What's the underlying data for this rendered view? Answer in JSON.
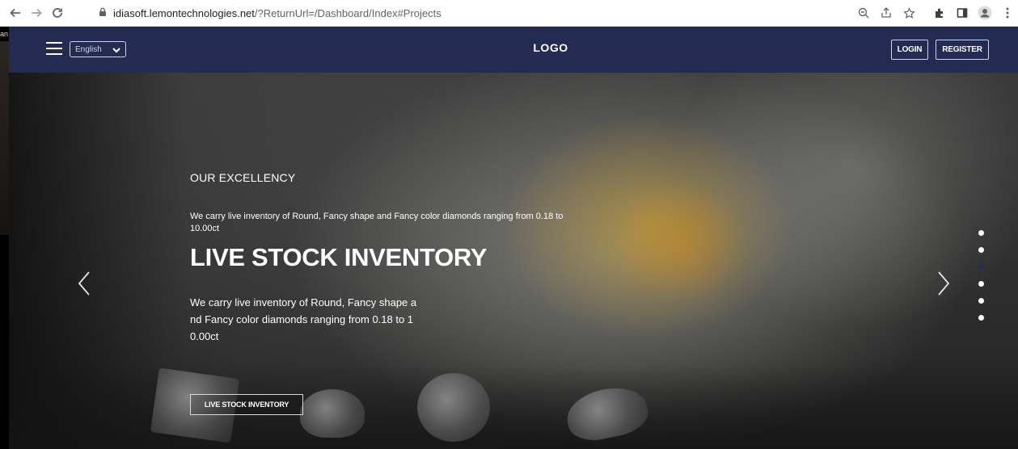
{
  "browser": {
    "url_host": "idiasoft.lemontechnologies.net",
    "url_path": "/?ReturnUrl=/Dashboard/Index#Projects"
  },
  "left_strip": {
    "fragment": "an"
  },
  "header": {
    "language": "English",
    "logo": "LOGO",
    "login_label": "LOGIN",
    "register_label": "REGISTER",
    "bg_color": "#232b52"
  },
  "hero": {
    "eyebrow": "OUR EXCELLENCY",
    "small_desc": "We carry live inventory of Round, Fancy shape and Fancy color diamonds ranging from 0.18 to 10.00ct",
    "title": "LIVE STOCK INVENTORY",
    "desc_line1": "We carry live inventory of Round, Fancy shape a",
    "desc_line2": "nd Fancy color diamonds ranging from 0.18 to 1",
    "desc_line3": "0.00ct",
    "cta_label": "LIVE STOCK INVENTORY"
  },
  "carousel": {
    "slide_count": 6,
    "active_index": 2,
    "active_color": "#232b52"
  }
}
